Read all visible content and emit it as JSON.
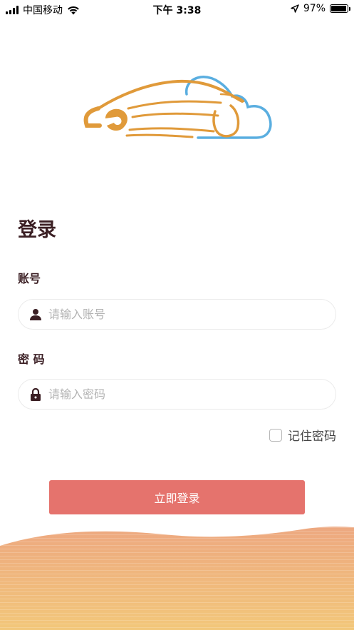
{
  "status_bar": {
    "carrier": "中国移动",
    "time": "下午 3:38",
    "battery": "97%",
    "battery_level": 0.97,
    "wifi_icon": "wifi-icon",
    "location_icon": "location-arrow-icon"
  },
  "logo": {
    "icon": "car-cloud-logo",
    "colors": {
      "car": "#e09a3a",
      "cloud": "#5aaee0"
    }
  },
  "page": {
    "title": "登录"
  },
  "form": {
    "account_label": "账号",
    "account_placeholder": "请输入账号",
    "account_value": "",
    "account_icon": "user-icon",
    "password_label": "密 码",
    "password_placeholder": "请输入密码",
    "password_value": "",
    "password_icon": "lock-icon",
    "remember_label": "记住密码",
    "remember_checked": false,
    "submit_label": "立即登录"
  },
  "colors": {
    "accent": "#e5736d",
    "text_dark": "#3b1f24",
    "wave_top": "#eda880",
    "wave_bottom": "#f2c77a"
  }
}
